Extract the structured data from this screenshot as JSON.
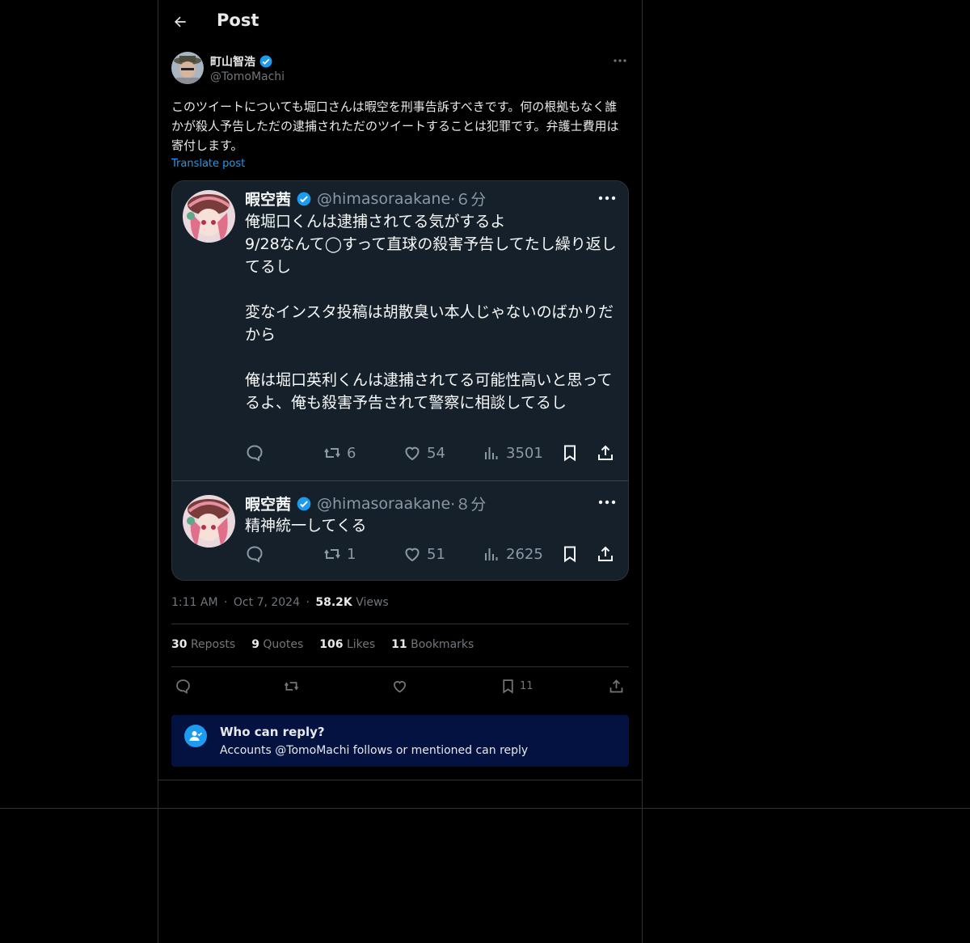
{
  "header": {
    "title": "Post"
  },
  "author": {
    "name": "町山智浩",
    "handle": "@TomoMachi"
  },
  "post": {
    "text": "このツイートについても堀口さんは暇空を刑事告訴すべきです。何の根拠もなく誰かが殺人予告しただの逮捕されただのツイートすることは犯罪です。弁護士費用は寄付します。",
    "translate_label": "Translate post"
  },
  "embedded": [
    {
      "name": "暇空茜",
      "handle": "@himasoraakane",
      "time": "·６分",
      "text": "俺堀口くんは逮捕されてる気がするよ\n9/28なんて◯すって直球の殺害予告してたし繰り返してるし\n\n変なインスタ投稿は胡散臭い本人じゃないのばかりだから\n\n俺は堀口英利くんは逮捕されてる可能性高いと思ってるよ、俺も殺害予告されて警察に相談してるし",
      "reposts": "6",
      "likes": "54",
      "views": "3501"
    },
    {
      "name": "暇空茜",
      "handle": "@himasoraakane",
      "time": "·８分",
      "text": "精神統一してくる",
      "reposts": "1",
      "likes": "51",
      "views": "2625"
    }
  ],
  "meta": {
    "time": "1:11 AM",
    "sep1": "·",
    "date": "Oct 7, 2024",
    "sep2": "·",
    "views_count": "58.2K",
    "views_label": "Views"
  },
  "stats": {
    "reposts_count": "30",
    "reposts_label": "Reposts",
    "quotes_count": "9",
    "quotes_label": "Quotes",
    "likes_count": "106",
    "likes_label": "Likes",
    "bookmarks_count": "11",
    "bookmarks_label": "Bookmarks"
  },
  "actions": {
    "bookmark_count": "11"
  },
  "reply_restriction": {
    "title": "Who can reply?",
    "subtitle": "Accounts @TomoMachi follows or mentioned can reply"
  },
  "colors": {
    "accent": "#1d9bf0",
    "verified": "#1d9bf0",
    "background": "#000000",
    "reply_box": "#031240"
  }
}
